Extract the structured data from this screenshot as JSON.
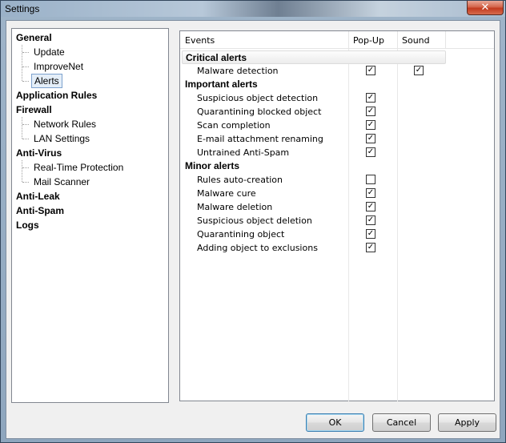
{
  "window": {
    "title": "Settings",
    "close_glyph": "✕"
  },
  "tree": {
    "groups": [
      {
        "label": "General",
        "children": [
          "Update",
          "ImproveNet",
          "Alerts"
        ]
      },
      {
        "label": "Application Rules",
        "children": []
      },
      {
        "label": "Firewall",
        "children": [
          "Network Rules",
          "LAN Settings"
        ]
      },
      {
        "label": "Anti-Virus",
        "children": [
          "Real-Time Protection",
          "Mail Scanner"
        ]
      },
      {
        "label": "Anti-Leak",
        "children": []
      },
      {
        "label": "Anti-Spam",
        "children": []
      },
      {
        "label": "Logs",
        "children": []
      }
    ],
    "selected": "Alerts"
  },
  "events": {
    "columns": {
      "events": "Events",
      "popup": "Pop-Up",
      "sound": "Sound"
    },
    "sections": [
      {
        "title": "Critical alerts",
        "rows": [
          {
            "label": "Malware detection",
            "popup": true,
            "sound": true
          }
        ]
      },
      {
        "title": "Important alerts",
        "rows": [
          {
            "label": "Suspicious object detection",
            "popup": true,
            "sound": false
          },
          {
            "label": "Quarantining blocked object",
            "popup": true,
            "sound": false
          },
          {
            "label": "Scan completion",
            "popup": true,
            "sound": false
          },
          {
            "label": "E-mail attachment renaming",
            "popup": true,
            "sound": false
          },
          {
            "label": "Untrained Anti-Spam",
            "popup": true,
            "sound": false
          }
        ]
      },
      {
        "title": "Minor alerts",
        "rows": [
          {
            "label": "Rules auto-creation",
            "popup": false,
            "sound": false
          },
          {
            "label": "Malware cure",
            "popup": true,
            "sound": false
          },
          {
            "label": "Malware deletion",
            "popup": true,
            "sound": false
          },
          {
            "label": "Suspicious object deletion",
            "popup": true,
            "sound": false
          },
          {
            "label": "Quarantining object",
            "popup": true,
            "sound": false
          },
          {
            "label": "Adding object to exclusions",
            "popup": true,
            "sound": false
          }
        ]
      }
    ]
  },
  "buttons": {
    "ok": "OK",
    "cancel": "Cancel",
    "apply": "Apply"
  },
  "check_glyph": "✓"
}
